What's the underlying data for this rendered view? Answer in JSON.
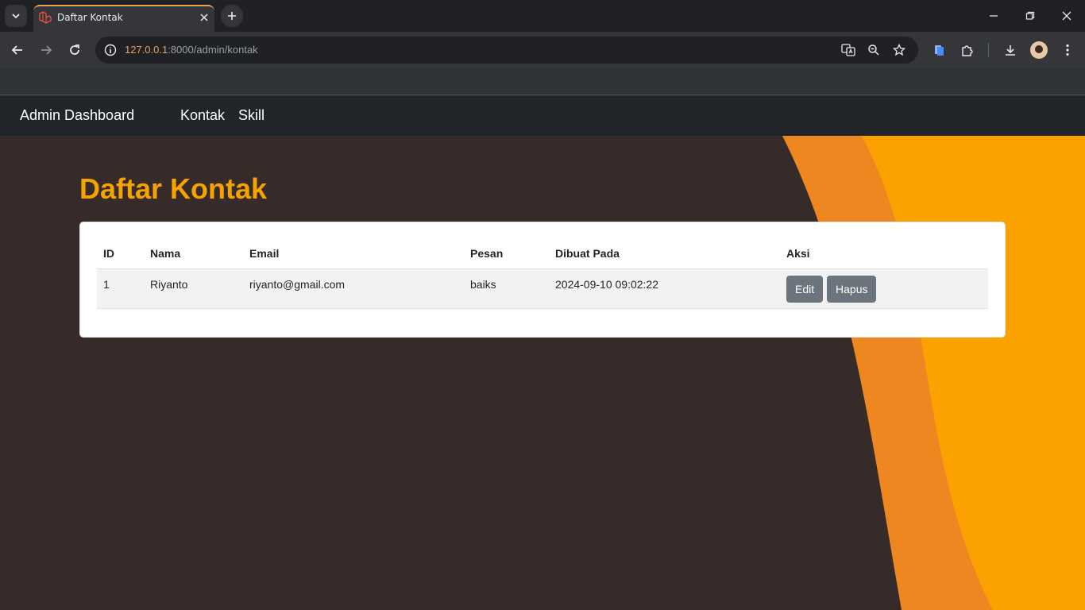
{
  "browser": {
    "tab_title": "Daftar Kontak",
    "url_host": "127.0.0.1",
    "url_rest": ":8000/admin/kontak",
    "icons": [
      "tab-search-icon",
      "laravel-favicon-icon",
      "close-icon",
      "plus-icon",
      "minimize-icon",
      "restore-icon",
      "window-close-icon",
      "back-icon",
      "forward-icon",
      "reload-icon",
      "site-info-icon",
      "translate-icon",
      "zoom-icon",
      "star-icon",
      "clipboard-icon",
      "extensions-icon",
      "download-icon",
      "profile-avatar",
      "menu-icon"
    ],
    "accent_color": "#e8a15a"
  },
  "navbar": {
    "brand": "Admin Dashboard",
    "links": [
      "Kontak",
      "Skill"
    ]
  },
  "page": {
    "title": "Daftar Kontak",
    "title_color": "#f6a300",
    "background_color": "#362b29",
    "wave_colors": [
      "#ee8720",
      "#fca200"
    ]
  },
  "table": {
    "headers": [
      "ID",
      "Nama",
      "Email",
      "Pesan",
      "Dibuat Pada",
      "Aksi"
    ],
    "rows": [
      {
        "id": "1",
        "nama": "Riyanto",
        "email": "riyanto@gmail.com",
        "pesan": "baiks",
        "dibuat_pada": "2024-09-10 09:02:22",
        "actions": [
          "Edit",
          "Hapus"
        ]
      }
    ]
  }
}
